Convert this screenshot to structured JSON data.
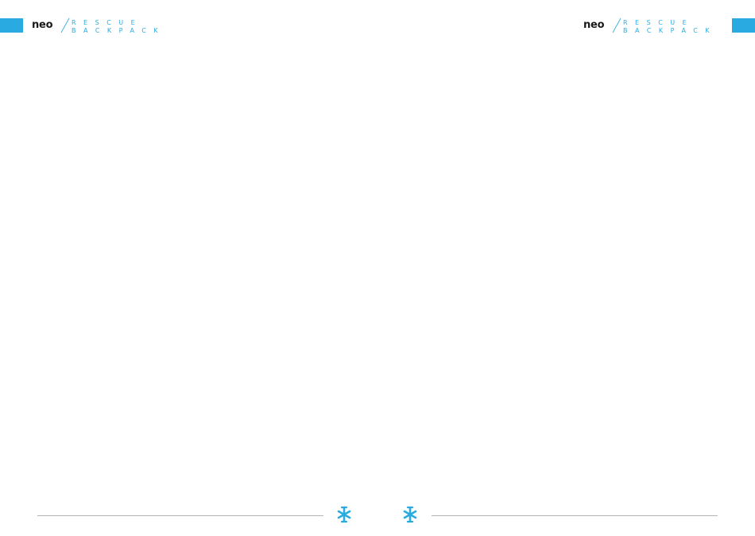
{
  "brand": {
    "logo_word": "neo",
    "line1": "RESCUE",
    "line2": "BACKPACK"
  },
  "colors": {
    "accent": "#29abe2",
    "logo_text": "#1a1a1a",
    "rule": "#b3b3b3"
  },
  "icons": {
    "footer_left": "asterisk-emblem-icon",
    "footer_right": "asterisk-emblem-icon"
  }
}
